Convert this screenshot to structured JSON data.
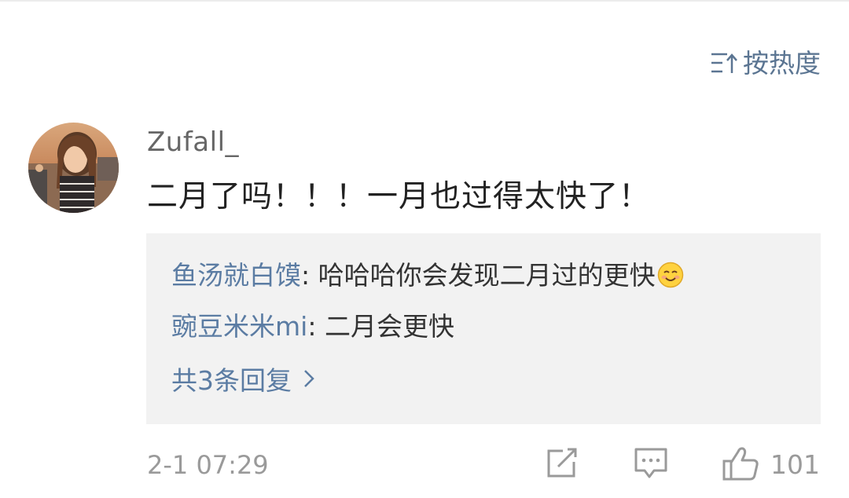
{
  "sort": {
    "label": "按热度"
  },
  "comment": {
    "username": "Zufall_",
    "text": "二月了吗！！！一月也过得太快了！",
    "timestamp": "2-1 07:29",
    "like_count": "101"
  },
  "replies": [
    {
      "name": "鱼汤就白馍",
      "separator": ": ",
      "text": "哈哈哈你会发现二月过的更快"
    },
    {
      "name": "豌豆米米mi",
      "separator": ": ",
      "text": "二月会更快"
    }
  ],
  "more_replies": {
    "label": "共3条回复"
  },
  "icons": {
    "sort": "sort-icon",
    "share": "share-edit-icon",
    "comment": "comment-bubble-icon",
    "like": "thumbs-up-icon",
    "chevron": "chevron-right-icon",
    "emoji": "smile-emoji-icon"
  },
  "colors": {
    "link": "#5b7ca3",
    "secondary": "#9a9a9a",
    "reply_bg": "#f2f2f2",
    "body_text": "#222222"
  }
}
